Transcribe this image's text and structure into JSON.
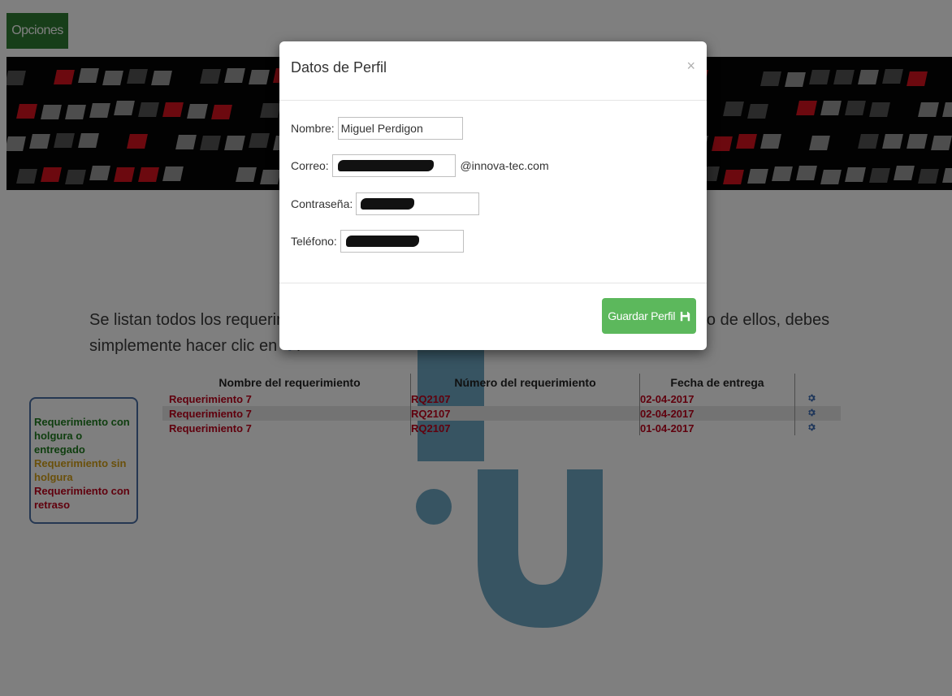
{
  "topbar": {
    "options_label": "Opciones"
  },
  "intro": {
    "line1_left": "Se listan todos los requerimie",
    "line1_right": "ón de alguno de ellos, debes",
    "line2": "simplemente hacer clic en",
    "gear_icon": "gear-icon"
  },
  "legend": {
    "on_time": "Requerimiento con holgura o entregado",
    "no_slack": "Requerimiento sin holgura",
    "delayed": "Requerimiento con retraso",
    "colors": {
      "on_time": "#1e7d1e",
      "no_slack": "#d4a017",
      "delayed": "#c0001a"
    }
  },
  "table": {
    "headers": [
      "Nombre del requerimiento",
      "Número del requerimiento",
      "Fecha de entrega"
    ],
    "rows": [
      {
        "name": "Requerimiento 7",
        "number": "RQ2107",
        "date": "02-04-2017"
      },
      {
        "name": "Requerimiento 7",
        "number": "RQ2107",
        "date": "02-04-2017"
      },
      {
        "name": "Requerimiento 7",
        "number": "RQ2107",
        "date": "01-04-2017"
      }
    ]
  },
  "modal": {
    "title": "Datos de Perfil",
    "close": "×",
    "fields": {
      "name_label": "Nombre:",
      "name_value": "Miguel Perdigon",
      "email_label": "Correo:",
      "email_suffix": "@innova-tec.com",
      "password_label": "Contraseña:",
      "phone_label": "Teléfono:"
    },
    "save_label": "Guardar Perfil",
    "save_icon": "floppy-disk-icon"
  },
  "colors": {
    "accent_green": "#5cb85c",
    "options_green": "#2e7d32",
    "danger_red": "#c0001a",
    "gear_blue": "#3d6db5"
  }
}
